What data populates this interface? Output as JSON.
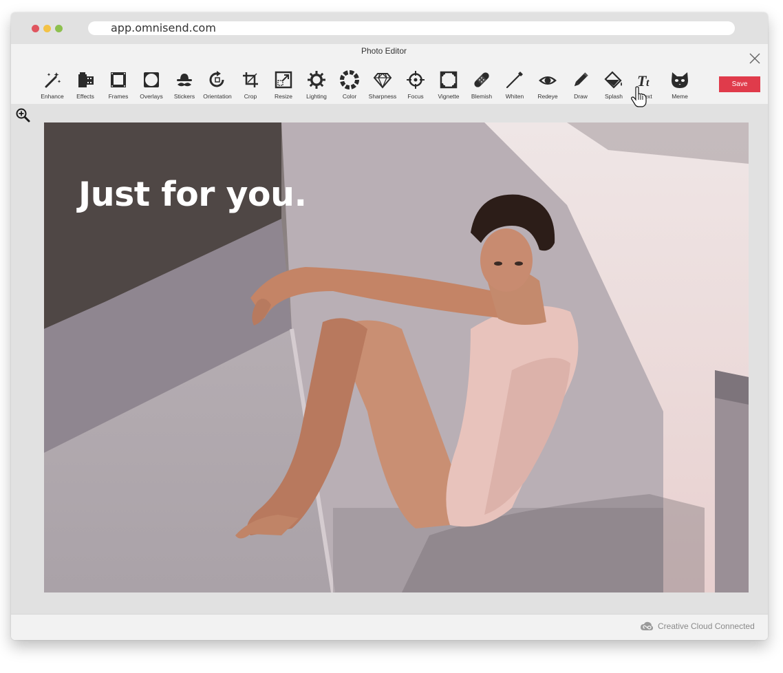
{
  "browser": {
    "url": "app.omnisend.com"
  },
  "editor": {
    "title": "Photo Editor",
    "save_label": "Save",
    "overlay_text": "Just for you.",
    "footer_status": "Creative Cloud Connected"
  },
  "tools": [
    {
      "label": "Enhance",
      "icon": "magic-wand-icon"
    },
    {
      "label": "Effects",
      "icon": "film-roll-icon"
    },
    {
      "label": "Frames",
      "icon": "frame-icon"
    },
    {
      "label": "Overlays",
      "icon": "overlay-icon"
    },
    {
      "label": "Stickers",
      "icon": "hat-mustache-icon"
    },
    {
      "label": "Orientation",
      "icon": "rotate-icon"
    },
    {
      "label": "Crop",
      "icon": "crop-icon"
    },
    {
      "label": "Resize",
      "icon": "resize-icon"
    },
    {
      "label": "Lighting",
      "icon": "sun-icon"
    },
    {
      "label": "Color",
      "icon": "color-wheel-icon"
    },
    {
      "label": "Sharpness",
      "icon": "diamond-icon"
    },
    {
      "label": "Focus",
      "icon": "crosshair-icon"
    },
    {
      "label": "Vignette",
      "icon": "vignette-icon"
    },
    {
      "label": "Blemish",
      "icon": "bandage-icon"
    },
    {
      "label": "Whiten",
      "icon": "toothbrush-icon"
    },
    {
      "label": "Redeye",
      "icon": "eye-icon"
    },
    {
      "label": "Draw",
      "icon": "pencil-icon"
    },
    {
      "label": "Splash",
      "icon": "paint-bucket-icon"
    },
    {
      "label": "Text",
      "icon": "text-icon"
    },
    {
      "label": "Meme",
      "icon": "cat-face-icon"
    }
  ],
  "colors": {
    "save": "#e03b4b",
    "icon": "#2b2b2b"
  }
}
